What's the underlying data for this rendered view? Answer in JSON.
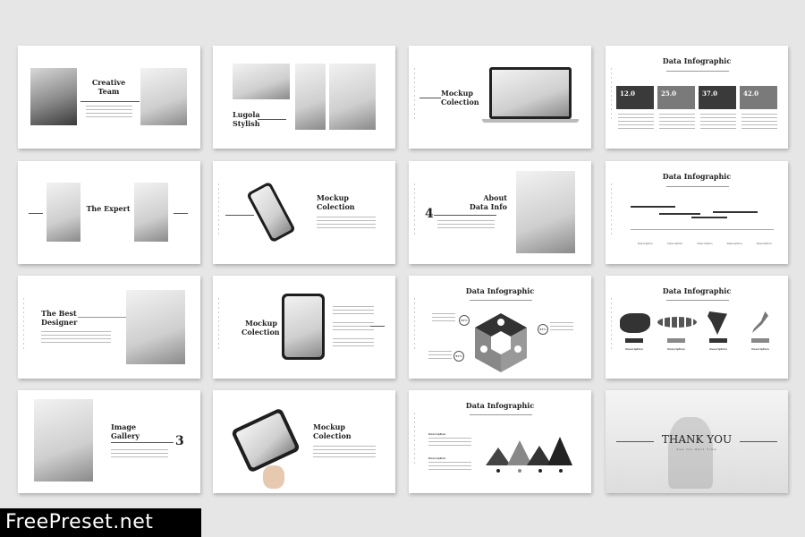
{
  "slides": [
    {
      "title": "Creative Team"
    },
    {
      "title": "Lugola Stylish"
    },
    {
      "title": "Mockup Colection"
    },
    {
      "title": "Data Infographic",
      "values": [
        "12.0",
        "25.0",
        "37.0",
        "42.0"
      ],
      "box_colors": [
        "#3a3a3a",
        "#7a7a7a",
        "#3a3a3a",
        "#7a7a7a"
      ]
    },
    {
      "title": "The Expert"
    },
    {
      "title": "Mockup Colection"
    },
    {
      "number": "4",
      "title": "About Data Info"
    },
    {
      "title": "Data Infographic",
      "legend": [
        "Description",
        "Description",
        "Description",
        "Description",
        "Description"
      ]
    },
    {
      "title": "The Best Designer"
    },
    {
      "title": "Mockup Colection"
    },
    {
      "title": "Data Infographic",
      "percents": [
        "87%",
        "87%",
        "87%"
      ],
      "icons": [
        "twitter-icon",
        "pinterest-icon",
        "facebook-icon"
      ]
    },
    {
      "title": "Data Infographic",
      "labels": [
        "Description",
        "Description",
        "Description",
        "Description"
      ],
      "maps": [
        "china-map",
        "indonesia-map",
        "india-map",
        "japan-map"
      ]
    },
    {
      "title": "Image Gallery",
      "number": "3"
    },
    {
      "title": "Mockup Colection"
    },
    {
      "title": "Data Infographic",
      "labels": [
        "Description",
        "Description"
      ]
    },
    {
      "title": "THANK YOU",
      "subtitle": "See You Next Time"
    }
  ],
  "watermark": "FreePreset.net",
  "colors": {
    "background": "#e6e6e6",
    "dark": "#3a3a3a",
    "mid": "#7a7a7a"
  }
}
